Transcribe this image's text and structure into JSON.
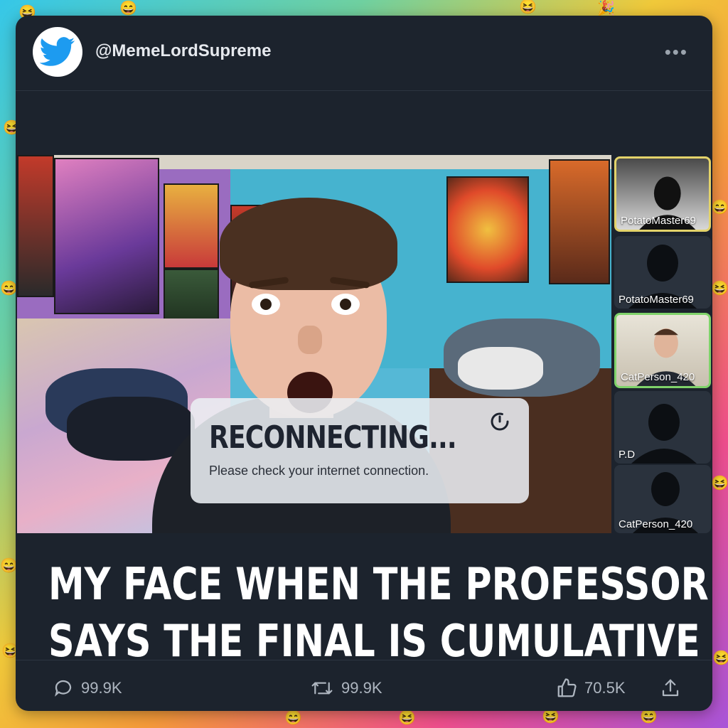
{
  "post": {
    "handle": "@MemeLordSupreme",
    "more_icon": "more-horizontal-icon",
    "caption_line1": "MY FACE WHEN THE PROFESSOR",
    "caption_line2": "SAYS THE FINAL IS CUMULATIVE"
  },
  "video_call": {
    "status_title": "RECONNECTING...",
    "status_message": "Please check your internet connection.",
    "participants": [
      {
        "name": "PotatoMaster69",
        "highlight": "#e3d36a"
      },
      {
        "name": "PotatoMaster69",
        "highlight": ""
      },
      {
        "name": "CatPerson_420",
        "highlight": "#7fd36a"
      },
      {
        "name": "P.D",
        "highlight": ""
      },
      {
        "name": "CatPerson_420",
        "highlight": ""
      }
    ]
  },
  "actions": {
    "replies": "99.9K",
    "reposts": "99.9K",
    "likes": "70.5K"
  },
  "colors": {
    "card_bg": "#1c232d",
    "accent_blue": "#1d9bf0",
    "text_muted": "#aeb6c0"
  }
}
